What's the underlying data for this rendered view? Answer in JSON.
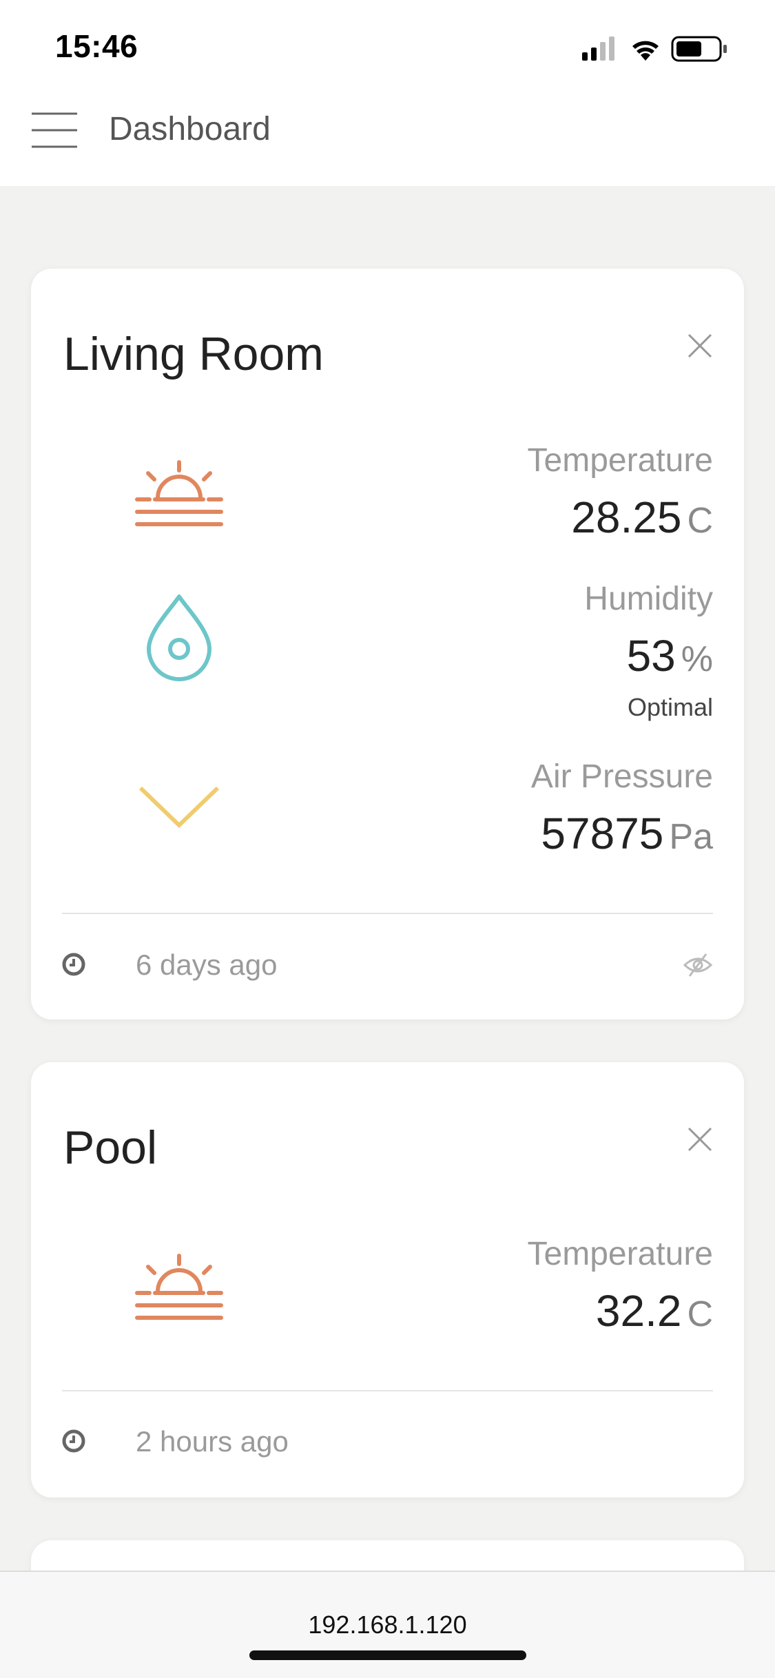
{
  "status_bar": {
    "time": "15:46",
    "signal_icon": "cellular-signal-icon",
    "wifi_icon": "wifi-icon",
    "battery_icon": "battery-icon"
  },
  "header": {
    "menu_icon": "hamburger-menu-icon",
    "title": "Dashboard"
  },
  "colors": {
    "temperature_icon": "#e0875e",
    "humidity_icon": "#6dc6c9",
    "pressure_icon": "#f0cc6e"
  },
  "cards": [
    {
      "title": "Living Room",
      "metrics": [
        {
          "label": "Temperature",
          "value": "28.25",
          "unit": "C",
          "icon": "sunrise-icon"
        },
        {
          "label": "Humidity",
          "value": "53",
          "unit": "%",
          "sub": "Optimal",
          "icon": "water-drop-icon"
        },
        {
          "label": "Air Pressure",
          "value": "57875",
          "unit": "Pa",
          "icon": "chevron-down-icon"
        }
      ],
      "updated": "6 days ago"
    },
    {
      "title": "Pool",
      "metrics": [
        {
          "label": "Temperature",
          "value": "32.2",
          "unit": "C",
          "icon": "sunrise-icon"
        }
      ],
      "updated": "2 hours ago"
    }
  ],
  "browser": {
    "url": "192.168.1.120"
  }
}
